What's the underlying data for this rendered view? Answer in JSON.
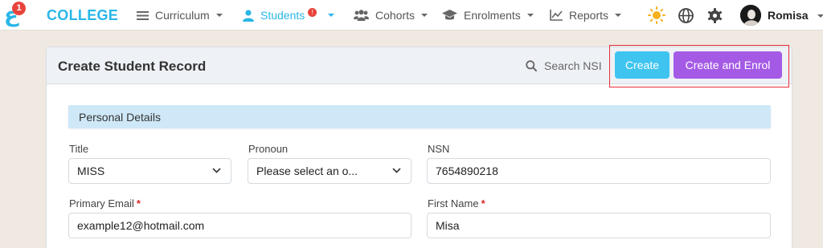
{
  "nav": {
    "logo_badge": "1",
    "brand": "COLLEGE",
    "items": [
      {
        "label": "Curriculum",
        "icon": "menu-lines-icon"
      },
      {
        "label": "Students",
        "icon": "person-icon",
        "badge": "!"
      },
      {
        "label": "Cohorts",
        "icon": "people-group-icon"
      },
      {
        "label": "Enrolments",
        "icon": "graduation-cap-icon"
      },
      {
        "label": "Reports",
        "icon": "line-chart-icon"
      }
    ],
    "user_name": "Romisa",
    "accent_color": "#29b6e8"
  },
  "card": {
    "title": "Create Student Record",
    "search_nsi_label": "Search NSI",
    "create_label": "Create",
    "create_enrol_label": "Create and Enrol",
    "section_title": "Personal Details"
  },
  "form": {
    "title": {
      "label": "Title",
      "value": "MISS"
    },
    "pronoun": {
      "label": "Pronoun",
      "value": "Please select an o..."
    },
    "nsn": {
      "label": "NSN",
      "value": "7654890218"
    },
    "primary_email": {
      "label": "Primary Email",
      "required_mark": "*",
      "value": "example12@hotmail.com"
    },
    "first_name": {
      "label": "First Name",
      "required_mark": "*",
      "value": "Misa"
    }
  }
}
